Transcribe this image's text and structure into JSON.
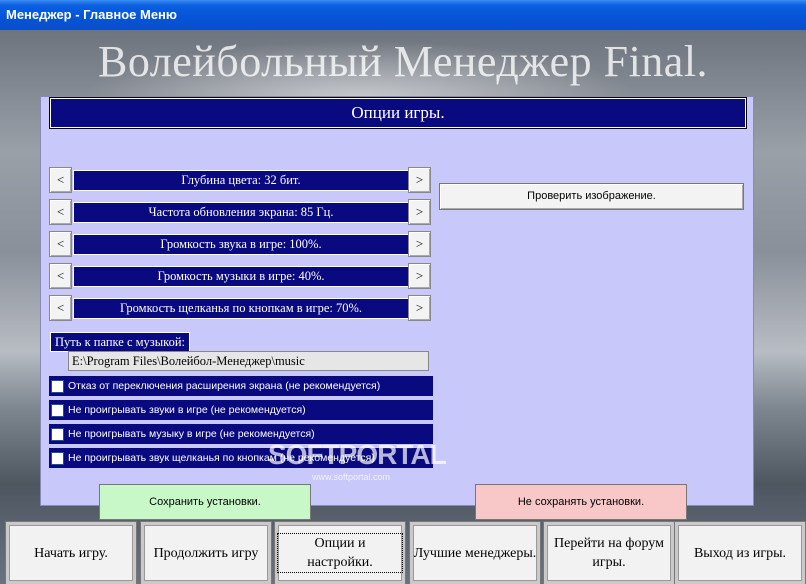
{
  "window": {
    "title": "Менеджер - Главное Меню"
  },
  "app_title": "Волейбольный Менеджер Final.",
  "panel": {
    "header": "Опции игры.",
    "options": [
      {
        "label": "Глубина цвета: 32 бит."
      },
      {
        "label": "Частота обновления экрана: 85 Гц."
      },
      {
        "label": "Громкость звука в игре: 100%."
      },
      {
        "label": "Громкость музыки в игре: 40%."
      },
      {
        "label": "Громкость щелканья по кнопкам в игре: 70%."
      }
    ],
    "arrow_left": "<",
    "arrow_right": ">",
    "check_image_button": "Проверить изображение.",
    "music_path_label": "Путь к папке с музыкой:",
    "music_path_value": "E:\\Program Files\\Волейбол-Менеджер\\music",
    "checkboxes": [
      {
        "label": "Отказ от переключения расширения экрана (не рекомендуется)",
        "checked": false
      },
      {
        "label": "Не проигрывать звуки в игре (не рекомендуется)",
        "checked": false
      },
      {
        "label": "Не проигрывать музыку в игре (не рекомендуется)",
        "checked": false
      },
      {
        "label": "Не проигрывать звук щелканья по кнопкам (не рекомендуется)",
        "checked": false
      }
    ],
    "save_button": "Сохранить установки.",
    "no_save_button": "Не сохранять установки."
  },
  "watermark": {
    "text": "SOFTPORTAL",
    "url": "www.softportal.com"
  },
  "bottom_nav": [
    {
      "label": "Начать игру."
    },
    {
      "label": "Продолжить игру"
    },
    {
      "label": "Опции и настройки."
    },
    {
      "label": "Лучшие менеджеры."
    },
    {
      "label": "Перейти на форум игры."
    },
    {
      "label": "Выход из игры."
    }
  ],
  "colors": {
    "header_navy": "#0a0a80",
    "panel_lavender": "#c8c8fa",
    "save_green": "#c8f8c8",
    "nosave_pink": "#f8c8c8",
    "titlebar_blue": "#0654d8"
  }
}
